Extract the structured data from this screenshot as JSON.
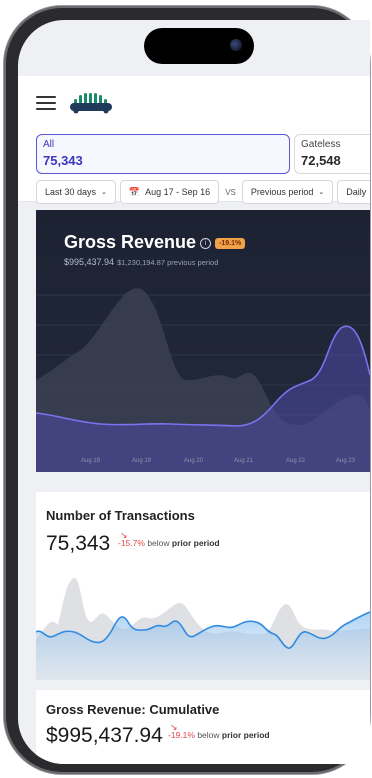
{
  "segments": {
    "all": {
      "label": "All",
      "value": "75,343"
    },
    "gateless": {
      "label": "Gateless",
      "value": "72,548"
    }
  },
  "filters": {
    "range": "Last 30 days",
    "dates": "Aug 17 - Sep 16",
    "vs": "VS",
    "compare": "Previous period",
    "interval": "Daily"
  },
  "revenue": {
    "title": "Gross Revenue",
    "badge": "-19.1%",
    "current": "$995,437.94",
    "previous": "$1,230,194.87 previous period",
    "x_labels": [
      "Aug 18",
      "Aug 19",
      "Aug 20",
      "Aug 21",
      "Aug 22",
      "Aug 23"
    ]
  },
  "transactions": {
    "title": "Number of Transactions",
    "value": "75,343",
    "delta": "-15.7%",
    "below": "below",
    "prior": "prior period"
  },
  "cumulative": {
    "title": "Gross Revenue: Cumulative",
    "value": "$995,437.94",
    "delta": "-19.1%",
    "below": "below",
    "prior": "prior period"
  },
  "colors": {
    "accent": "#5b57d6",
    "negative": "#e34747",
    "card_dark": "#1c2232",
    "line_current": "#6f67e8",
    "line_blue": "#2f8be0"
  }
}
